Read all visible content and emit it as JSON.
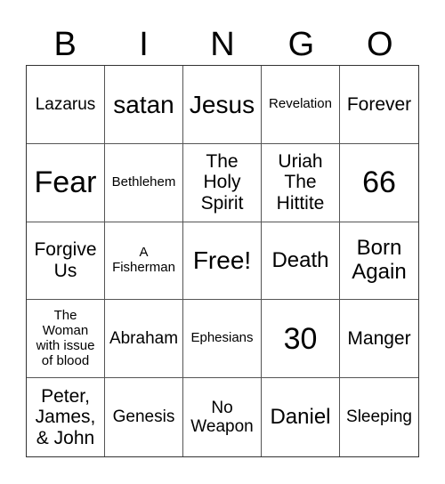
{
  "header": {
    "letters": [
      "B",
      "I",
      "N",
      "G",
      "O"
    ]
  },
  "cells": [
    "Lazarus",
    "satan",
    "Jesus",
    "Revelation",
    "Forever",
    "Fear",
    "Bethlehem",
    "The\nHoly\nSpirit",
    "Uriah\nThe\nHittite",
    "66",
    "Forgive\nUs",
    "A\nFisherman",
    "Free!",
    "Death",
    "Born\nAgain",
    "The\nWoman\nwith issue\nof blood",
    "Abraham",
    "Ephesians",
    "30",
    "Manger",
    "Peter,\nJames,\n& John",
    "Genesis",
    "No\nWeapon",
    "Daniel",
    "Sleeping"
  ]
}
